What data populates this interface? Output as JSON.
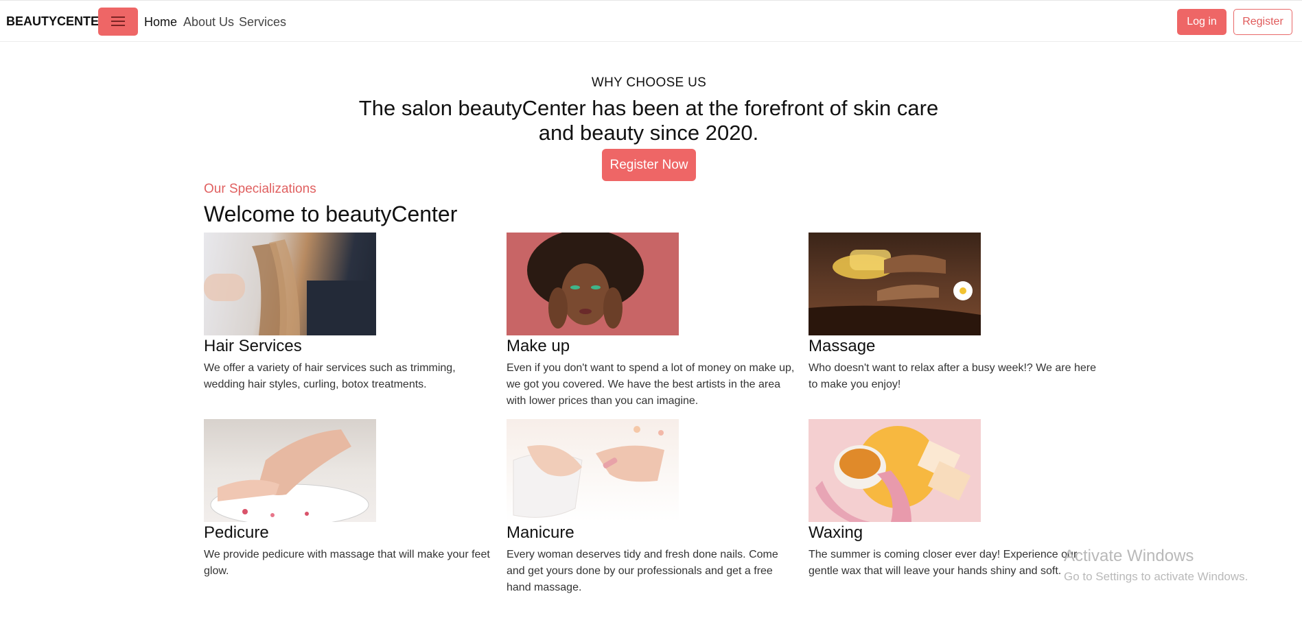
{
  "navbar": {
    "brand": "BEAUTYCENTER",
    "links": [
      "Home",
      "About Us",
      "Services"
    ],
    "login_label": "Log in",
    "register_label": "Register"
  },
  "hero": {
    "eyebrow": "WHY CHOOSE US",
    "title": "The salon beautyCenter has been at the forefront of skin care and beauty since 2020.",
    "cta_label": "Register Now"
  },
  "section": {
    "label": "Our Specializations",
    "title": "Welcome to beautyCenter"
  },
  "services": [
    {
      "title": "Hair Services",
      "text": "We offer a variety of hair services such as trimming, wedding hair styles, curling, botox treatments.",
      "image": "hair-stylist-photo"
    },
    {
      "title": "Make up",
      "text": "Even if you don't want to spend a lot of money on make up, we got you covered. We have the best artists in the area with lower prices than you can imagine.",
      "image": "makeup-model-photo"
    },
    {
      "title": "Massage",
      "text": "Who doesn't want to relax after a busy week!? We are here to make you enjoy!",
      "image": "massage-oil-photo"
    },
    {
      "title": "Pedicure",
      "text": "We provide pedicure with massage that will make your feet glow.",
      "image": "foot-bath-photo"
    },
    {
      "title": "Manicure",
      "text": "Every woman deserves tidy and fresh done nails. Come and get yours done by our professionals and get a free hand massage.",
      "image": "nail-polish-photo"
    },
    {
      "title": "Waxing",
      "text": "The summer is coming closer ever day! Experience our gentle wax that will leave your hands shiny and soft.",
      "image": "wax-bowl-photo"
    }
  ],
  "watermark": {
    "line1": "Activate Windows",
    "line2": "Go to Settings to activate Windows."
  },
  "colors": {
    "accent": "#ee6666",
    "text": "#111111"
  }
}
